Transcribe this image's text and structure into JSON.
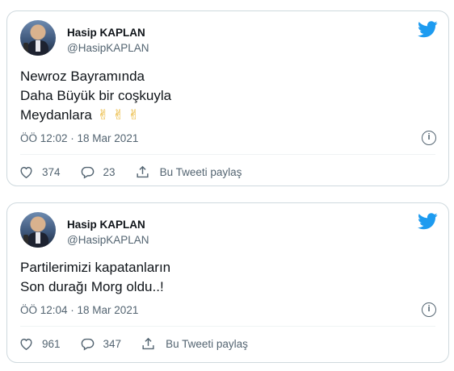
{
  "tweets": [
    {
      "author_name": "Hasip KAPLAN",
      "author_handle": "@HasipKAPLAN",
      "text": "Newroz Bayramında\nDaha Büyük bir coşkuyla\nMeydanlara",
      "emoji": "✌ ✌ ✌",
      "timestamp": "ÖÖ 12:02 · 18 Mar 2021",
      "likes": "374",
      "replies": "23",
      "share_label": "Bu Tweeti paylaş"
    },
    {
      "author_name": "Hasip KAPLAN",
      "author_handle": "@HasipKAPLAN",
      "text": "Partilerimizi kapatanların\nSon durağı Morg oldu..!",
      "timestamp": "ÖÖ 12:04 · 18 Mar 2021",
      "likes": "961",
      "replies": "347",
      "share_label": "Bu Tweeti paylaş"
    }
  ],
  "icons": {
    "brand": "twitter-bird-icon",
    "info": "info-icon",
    "like": "heart-icon",
    "reply": "reply-icon",
    "share": "share-icon"
  },
  "colors": {
    "twitter_blue": "#1d9bf0",
    "secondary_text": "#536471",
    "border": "#cfd9de"
  }
}
